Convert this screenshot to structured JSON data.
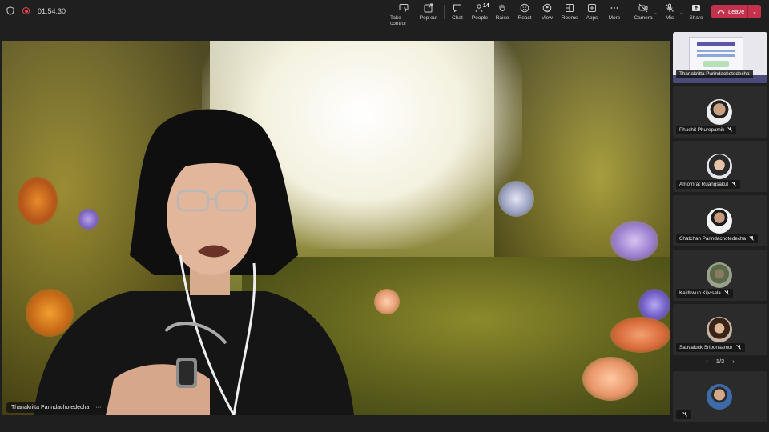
{
  "call": {
    "timer": "01:54:30"
  },
  "toolbar": {
    "take_control": "Take control",
    "pop_out": "Pop out",
    "chat": "Chat",
    "people": "People",
    "people_count": "14",
    "raise": "Raise",
    "react": "React",
    "view": "View",
    "rooms": "Rooms",
    "apps": "Apps",
    "more": "More",
    "camera": "Camera",
    "mic": "Mic",
    "share": "Share",
    "leave": "Leave"
  },
  "stage": {
    "name": "Thanakritta Parindachotedecha"
  },
  "participants": [
    {
      "name": "Thanakritta Parindachotedecha",
      "sharing": true
    },
    {
      "name": "Phuchit Phurepamik"
    },
    {
      "name": "Amornrat Ruangsakul"
    },
    {
      "name": "Chatchan Parindachotedecha"
    },
    {
      "name": "Kajitkwun Kijvisala"
    },
    {
      "name": "Saovaluck Sriponsamor"
    },
    {
      "name": ""
    }
  ],
  "pager": {
    "label": "1/3"
  },
  "colors": {
    "leave": "#c4314b",
    "recording": "#e5484d"
  }
}
